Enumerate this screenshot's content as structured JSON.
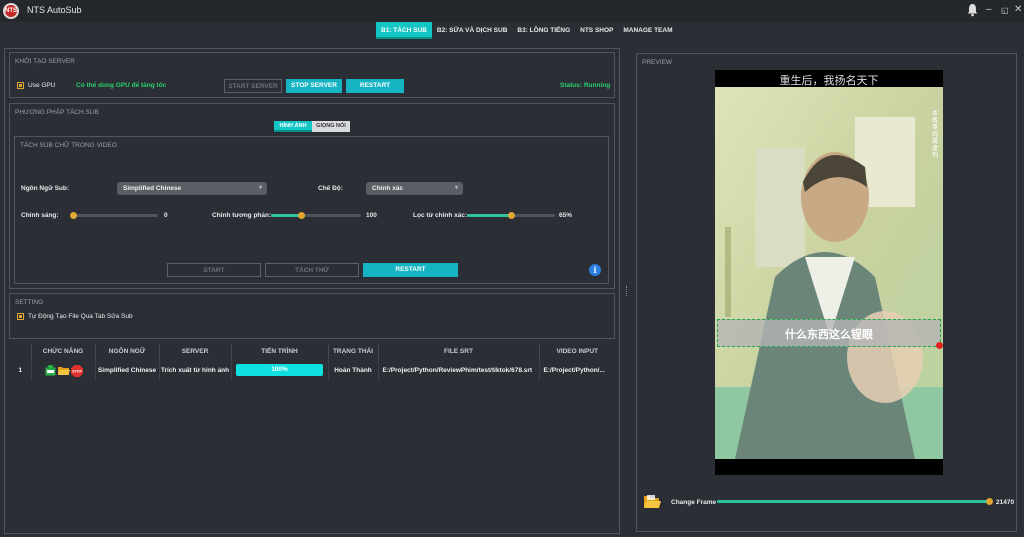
{
  "app": {
    "logo_text": "NTS",
    "title": "NTS AutoSub"
  },
  "tabs": [
    {
      "label": "B1: TÁCH SUB",
      "active": true
    },
    {
      "label": "B2: SỬA VÀ DỊCH SUB"
    },
    {
      "label": "B3: LỒNG TIẾNG"
    },
    {
      "label": "NTS SHOP"
    },
    {
      "label": "MANAGE TEAM"
    }
  ],
  "server": {
    "section_title": "KHỞI TẠO SERVER",
    "use_gpu_label": "Use GPU",
    "use_gpu_checked": true,
    "gpu_note": "Có thể dùng GPU để tăng tốc",
    "start_label": "START SERVER",
    "stop_label": "STOP SERVER",
    "restart_label": "RESTART",
    "status_text": "Status: Running"
  },
  "method": {
    "section_title": "PHƯƠNG PHÁP TÁCH SUB",
    "seg_image": "HÌNH ẢNH",
    "seg_voice": "GIỌNG NÓI",
    "sub_title": "TÁCH SUB CHỮ TRONG VIDEO",
    "lang_label": "Ngôn Ngữ Sub:",
    "lang_value": "Simplified Chinese",
    "mode_label": "Chế Độ:",
    "mode_value": "Chính xác",
    "brightness_label": "Chỉnh sáng:",
    "brightness_value": "0",
    "brightness_level": 0,
    "contrast_label": "Chỉnh tương phản:",
    "contrast_value": "100",
    "contrast_level": 0.33,
    "filter_label": "Lọc từ chính xác:",
    "filter_value": "65%",
    "filter_level": 0.5,
    "start_label": "START",
    "test_label": "TÁCH THỬ",
    "restart_label": "RESTART"
  },
  "setting": {
    "section_title": "SETTING",
    "auto_create_label": "Tự Động Tạo File Qua Tab Sửa Sub",
    "auto_create_checked": true
  },
  "table": {
    "headers": [
      "",
      "CHỨC NĂNG",
      "NGÔN NGỮ",
      "SERVER",
      "TIẾN TRÌNH",
      "TRẠNG THÁI",
      "FILE SRT",
      "VIDEO INPUT"
    ],
    "rows": [
      {
        "index": "1",
        "language": "Simplified Chinese",
        "server": "Trích xuất từ hình ảnh",
        "progress": "100%",
        "status": "Hoàn Thành",
        "file_srt": "E:/Project/Python/ReviewPhim/test/tiktok/678.srt",
        "video_input": "E:/Project/Python/..."
      }
    ]
  },
  "preview": {
    "section_title": "PREVIEW",
    "video_caption_top": "重生后，我扬名天下",
    "subtitle_text": "什么东西这么锃眼",
    "side_text_right": "本故事纯属虚构",
    "change_frame_label": "Change Frame",
    "frame_value": "21470",
    "frame_level": 1.0
  },
  "colors": {
    "accent": "#15b4c2",
    "status_green": "#28d16b",
    "knob": "#e0a830"
  }
}
